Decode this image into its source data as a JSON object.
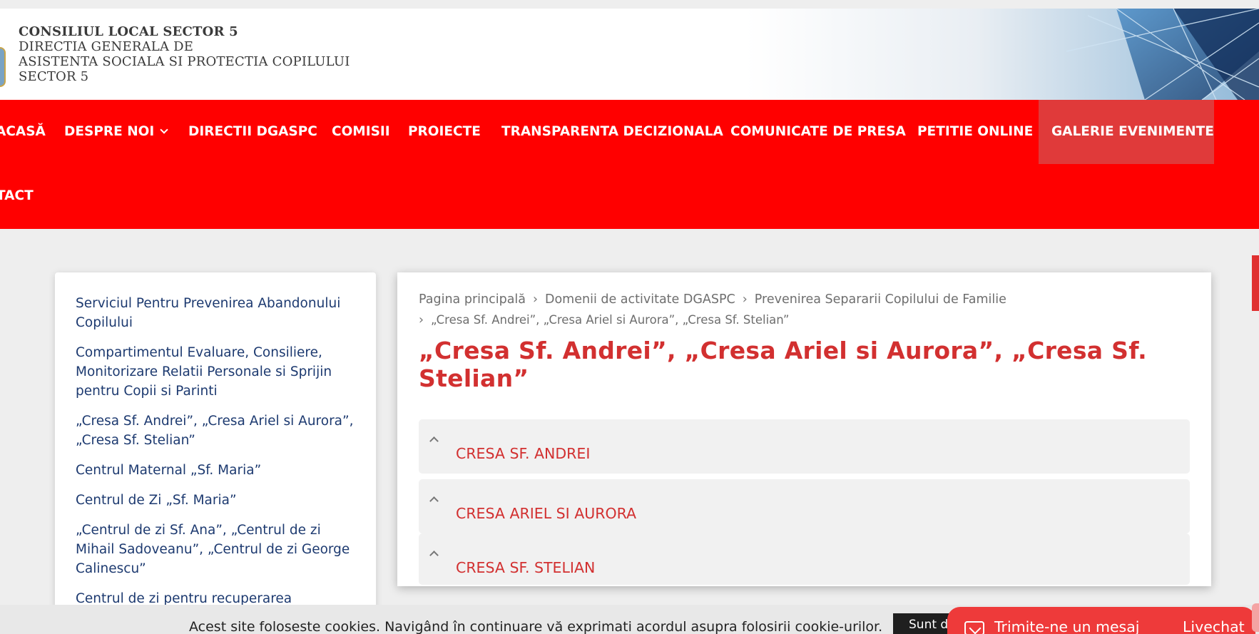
{
  "header": {
    "org_lines": [
      "CONSILIUL LOCAL SECTOR 5",
      "DIRECTIA GENERALA DE",
      "ASISTENTA SOCIALA SI PROTECTIA COPILULUI",
      "SECTOR 5"
    ]
  },
  "nav": {
    "items": [
      "ACASĂ",
      "DESPRE NOI",
      "DIRECTII DGASPC",
      "COMISII",
      "PROIECTE",
      "TRANSPARENTA DECIZIONALA",
      "COMUNICATE DE PRESA",
      "PETITIE ONLINE",
      "GALERIE EVENIMENTE",
      "TACT"
    ],
    "active": "GALERIE EVENIMENTE",
    "colors": {
      "bar": "#ff0000",
      "active": "#e03a3a"
    }
  },
  "sidebar": {
    "links": [
      "Serviciul Pentru Prevenirea Abandonului Copilului",
      "Compartimentul Evaluare, Consiliere, Monitorizare Relatii Personale si Sprijin pentru Copii si Parinti",
      "„Cresa Sf. Andrei”, „Cresa Ariel si Aurora”, „Cresa Sf. Stelian”",
      "Centrul Maternal „Sf. Maria”",
      "Centrul de Zi „Sf. Maria”",
      "„Centrul de zi Sf. Ana”, „Centrul de zi Mihail Sadoveanu”, „Centrul de zi George Calinescu”",
      "Centrul de zi pentru recuperarea"
    ]
  },
  "breadcrumb": {
    "items": [
      "Pagina principală",
      "Domenii de activitate DGASPC",
      "Prevenirea Separarii Copilului de Familie"
    ],
    "current": "„Cresa Sf. Andrei”, „Cresa Ariel si Aurora”, „Cresa Sf. Stelian”"
  },
  "main": {
    "title": "„Cresa Sf. Andrei”, „Cresa Ariel si Aurora”, „Cresa Sf. Stelian”",
    "accordion": [
      "CRESA SF. ANDREI",
      "CRESA ARIEL SI AURORA",
      "CRESA SF. STELIAN"
    ],
    "accent_color": "#d23030"
  },
  "cookie": {
    "text": "Acest site foloseste cookies. Navigând în continuare vă exprimati acordul asupra folosirii cookie-urilor.",
    "button": "Sunt de acord"
  },
  "chat": {
    "label": "Trimite-ne un mesaj",
    "label2": "Livechat"
  }
}
